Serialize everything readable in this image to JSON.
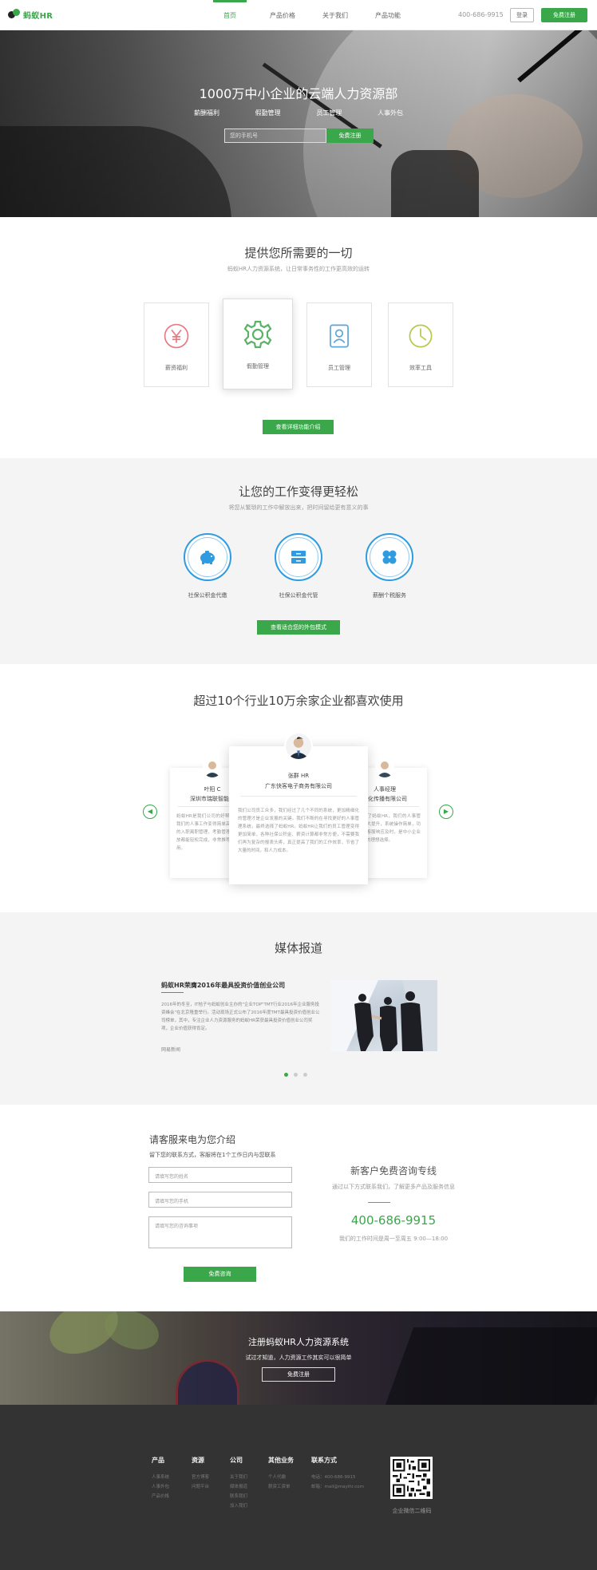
{
  "nav": {
    "logo_text": "蚂蚁HR",
    "items": [
      "首页",
      "产品价格",
      "关于我们",
      "产品功能"
    ],
    "active_index": 0,
    "phone": "400-686-9915",
    "login": "登录",
    "register": "免费注册"
  },
  "hero": {
    "title": "1000万中小企业的云端人力资源部",
    "links": [
      "薪酬福利",
      "假勤管理",
      "员工管理",
      "人事外包"
    ],
    "input_placeholder": "您的手机号",
    "button": "免费注册"
  },
  "features": {
    "title": "提供您所需要的一切",
    "subtitle": "蚂蚁HR人力资源系统，让日常事务性的工作更高效的运转",
    "cards": [
      {
        "label": "薪资福利",
        "icon": "yen-icon",
        "color": "#e77b84"
      },
      {
        "label": "假勤管理",
        "icon": "gear-icon",
        "color": "#59b266"
      },
      {
        "label": "员工管理",
        "icon": "badge-icon",
        "color": "#5aa6d8"
      },
      {
        "label": "效率工具",
        "icon": "clock-icon",
        "color": "#b6c94a"
      }
    ],
    "button": "查看详细功能介绍"
  },
  "outsourcing": {
    "title": "让您的工作变得更轻松",
    "subtitle": "将您从繁琐的工作中解放出来，把时间留给更有意义的事",
    "items": [
      {
        "label": "社保公积金代缴",
        "icon": "piggy-bank-icon"
      },
      {
        "label": "社保公积金代管",
        "icon": "drawer-icon"
      },
      {
        "label": "薪酬个税服务",
        "icon": "clover-icon"
      }
    ],
    "button": "查看适合您的外包模式"
  },
  "testimonials": {
    "title": "超过10个行业10万余家企业都喜欢使用",
    "left": {
      "name": "叶阳 C",
      "company": "深圳市瑞联智能控"
    },
    "center": {
      "name": "张群 HR",
      "company": "广东快客电子商务有限公司",
      "body": "我们公司员工众多，我们经过了几个不同的系统，更加精细化的管理才是企业发展的关键。我们不断的在寻找更好的人事管理系统，最终选择了蚂蚁HR。蚂蚁HR让我们的员工管理变得更加简单，各种社保公积金、薪资计算都非常方便，不需要我们再为复杂的报表头疼，真正提高了我们的工作效率，节省了大量的时间，和人力成本。"
    },
    "right": {
      "name": "人事经理",
      "company": "文化传播有限公司"
    },
    "left_body": "蚂蚁HR是我们公司的好帮手，它让我们的人事工作变得简单高效，员工的入职离职管理，考勤管理，薪资发放都能轻松完成，非常推荐给大家使用。",
    "right_body": "自从使用了蚂蚁HR，我们的人事管理效率大大提升，系统操作简单，功能全面，客服响应及时，是中小企业人事管理的理想选择。"
  },
  "media": {
    "title": "媒体报道",
    "article_title": "蚂蚁HR荣膺2016年最具投资价值创业公司",
    "article_body": "2016年的冬至，IT桔子与蚂蚁创业主办的\"企业TOP\"TMT行业2016年企业服务投资峰会\"在北京隆重举行。活动现场正式公布了2016年度TMT最具投资价值创业公司榜单，其中，专注企业人力资源服务的蚂蚁HR荣获最具投资价值创业公司奖项，企业价值获得肯定。",
    "article_source": "网易新闻",
    "slide_count": 3,
    "active_slide": 0
  },
  "contact": {
    "title": "请客服来电为您介绍",
    "subtitle": "留下您的联系方式，客服将在1个工作日内与您联系",
    "name_placeholder": "请填写您的姓名",
    "phone_placeholder": "请填写您的手机",
    "need_placeholder": "请填写您的咨询事项",
    "button": "免费咨询",
    "hotline_title": "新客户免费咨询专线",
    "hotline_sub": "通过以下方式联系我们，了解更多产品及服务信息",
    "phone": "400-686-9915",
    "hours": "我们的工作时间是周一至周五 9:00—18:00"
  },
  "cta": {
    "title": "注册蚂蚁HR人力资源系统",
    "subtitle": "试过才知道，人力资源工作其实可以很简单",
    "button": "免费注册"
  },
  "footer": {
    "columns": [
      {
        "head": "产品",
        "items": [
          "人事系统",
          "人事外包",
          "产品价格"
        ]
      },
      {
        "head": "资源",
        "items": [
          "官方博客",
          "问题平台"
        ]
      },
      {
        "head": "公司",
        "items": [
          "关于我们",
          "媒体报道",
          "联系我们",
          "加入我们"
        ]
      },
      {
        "head": "其他业务",
        "items": [
          "个人代缴",
          "薪资工资单"
        ]
      },
      {
        "head": "联系方式",
        "items": [
          "电话：400-686-9915",
          "邮箱：mail@mayihr.com"
        ]
      }
    ],
    "qr_caption": "企业微信二维码"
  }
}
